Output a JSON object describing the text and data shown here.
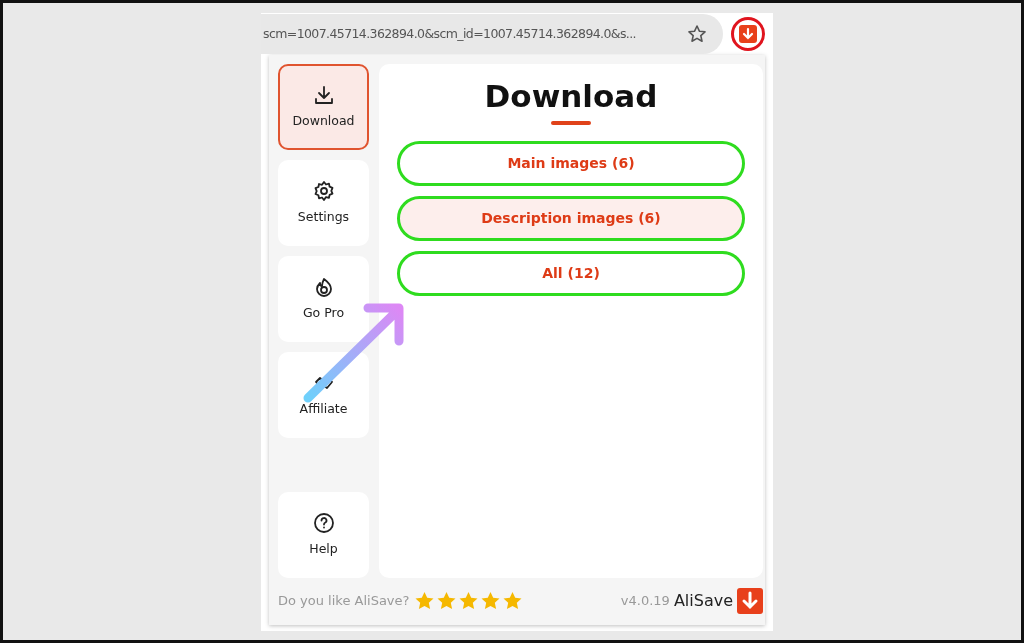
{
  "address_bar": {
    "url": "scm=1007.45714.362894.0&scm_id=1007.45714.362894.0&s..."
  },
  "sidebar": {
    "items": [
      {
        "label": "Download",
        "selected": true
      },
      {
        "label": "Settings",
        "selected": false
      },
      {
        "label": "Go Pro",
        "selected": false
      },
      {
        "label": "Affiliate",
        "selected": false
      },
      {
        "label": "Help",
        "selected": false
      }
    ]
  },
  "panel": {
    "title": "Download",
    "buttons": [
      {
        "label": "Main images (6)",
        "highlighted": false
      },
      {
        "label": "Description images (6)",
        "highlighted": true
      },
      {
        "label": "All (12)",
        "highlighted": false
      }
    ]
  },
  "footer": {
    "question": "Do you like AliSave?",
    "stars": 5,
    "version": "v4.0.19",
    "brand": "AliSave"
  }
}
